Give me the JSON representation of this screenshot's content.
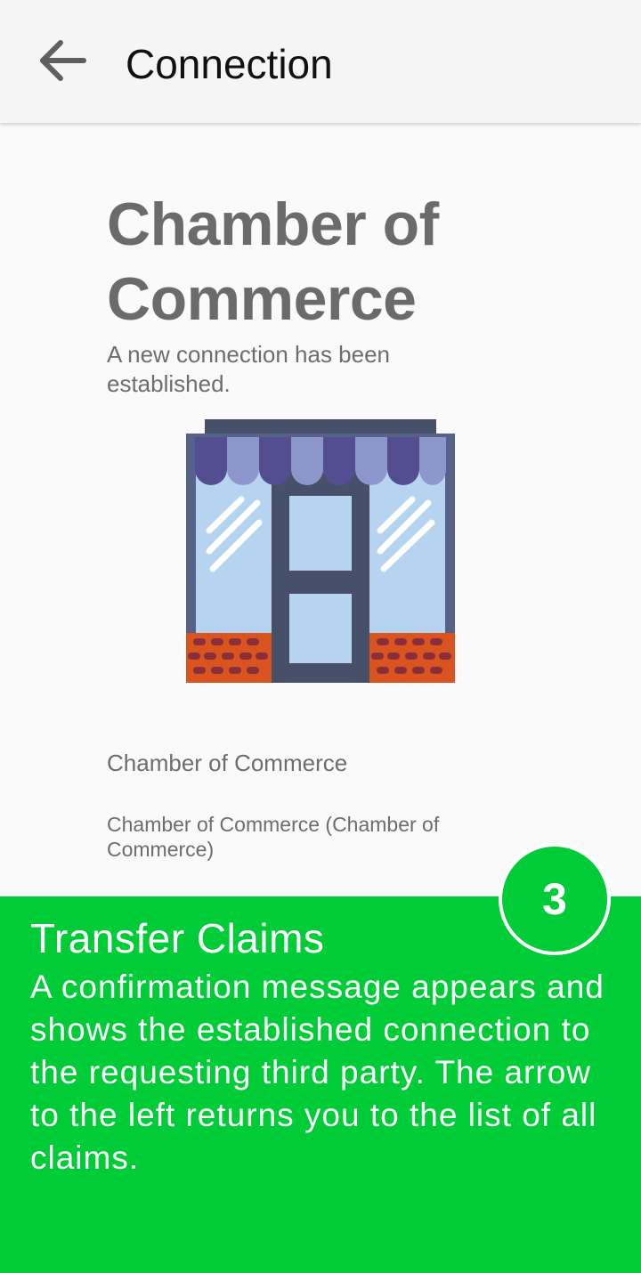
{
  "appbar": {
    "title": "Connection",
    "back_icon": "arrow-left-icon"
  },
  "connection": {
    "org_title": "Chamber of Commerce",
    "subtitle": "A new connection has been established.",
    "illustration_icon": "storefront-icon",
    "name": "Chamber of Commerce",
    "detail": "Chamber of Commerce (Chamber of Commerce)"
  },
  "tutorial": {
    "step": "3",
    "title": "Transfer Claims",
    "body": "A confirmation message appears and shows the established connection to the requesting third party. The arrow to the left returns you to the list of all claims.",
    "accent_color": "#00cc37"
  }
}
